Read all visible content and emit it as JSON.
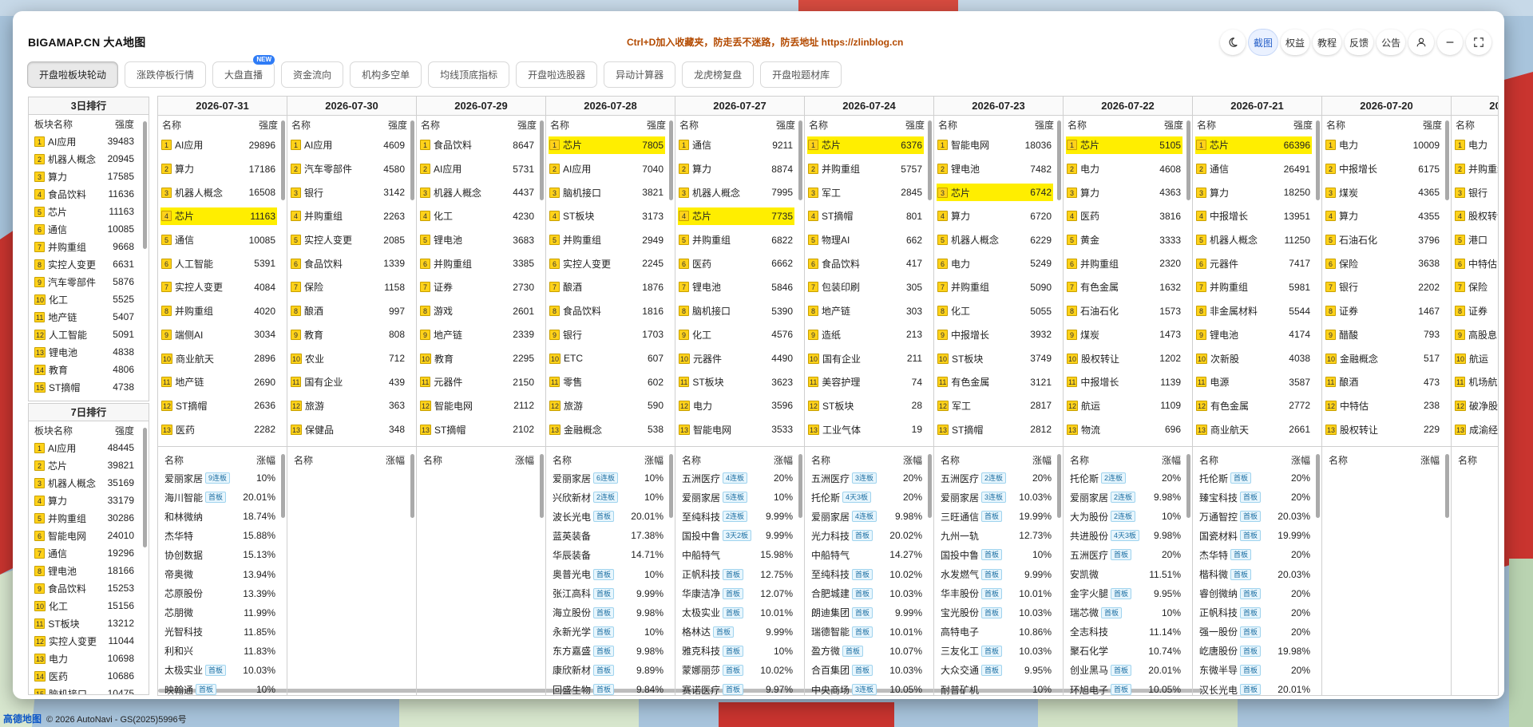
{
  "app": {
    "title": "BIGAMAP.CN 大A地图",
    "notice": "Ctrl+D加入收藏夹，防走丢不迷路，防丢地址 https://zlinblog.cn"
  },
  "top_buttons": [
    "截图",
    "权益",
    "教程",
    "反馈",
    "公告"
  ],
  "tabs": [
    {
      "label": "开盘啦板块轮动",
      "active": true
    },
    {
      "label": "涨跌停板行情"
    },
    {
      "label": "大盘直播",
      "badge": "NEW"
    },
    {
      "label": "资金流向"
    },
    {
      "label": "机构多空单"
    },
    {
      "label": "均线顶底指标"
    },
    {
      "label": "开盘啦选股器"
    },
    {
      "label": "异动计算器"
    },
    {
      "label": "龙虎榜复盘"
    },
    {
      "label": "开盘啦题材库"
    }
  ],
  "rank3": {
    "title": "3日排行",
    "col_name": "板块名称",
    "col_strength": "强度",
    "rows": [
      [
        "AI应用",
        "39483"
      ],
      [
        "机器人概念",
        "20945"
      ],
      [
        "算力",
        "17585"
      ],
      [
        "食品饮料",
        "11636"
      ],
      [
        "芯片",
        "11163"
      ],
      [
        "通信",
        "10085"
      ],
      [
        "并购重组",
        "9668"
      ],
      [
        "实控人变更",
        "6631"
      ],
      [
        "汽车零部件",
        "5876"
      ],
      [
        "化工",
        "5525"
      ],
      [
        "地产链",
        "5407"
      ],
      [
        "人工智能",
        "5091"
      ],
      [
        "锂电池",
        "4838"
      ],
      [
        "教育",
        "4806"
      ],
      [
        "ST摘帽",
        "4738"
      ]
    ]
  },
  "rank7": {
    "title": "7日排行",
    "col_name": "板块名称",
    "col_strength": "强度",
    "rows": [
      [
        "AI应用",
        "48445"
      ],
      [
        "芯片",
        "39821"
      ],
      [
        "机器人概念",
        "35169"
      ],
      [
        "算力",
        "33179"
      ],
      [
        "并购重组",
        "30286"
      ],
      [
        "智能电网",
        "24010"
      ],
      [
        "通信",
        "19296"
      ],
      [
        "锂电池",
        "18166"
      ],
      [
        "食品饮料",
        "15253"
      ],
      [
        "化工",
        "15156"
      ],
      [
        "ST板块",
        "13212"
      ],
      [
        "实控人变更",
        "11044"
      ],
      [
        "电力",
        "10698"
      ],
      [
        "医药",
        "10686"
      ],
      [
        "脑机接口",
        "10475"
      ]
    ]
  },
  "grid": {
    "col_name": "名称",
    "col_strength": "强度",
    "col_change": "涨幅",
    "days": [
      {
        "date": "2026-07-31",
        "sectors": [
          [
            "AI应用",
            "29896"
          ],
          [
            "算力",
            "17186"
          ],
          [
            "机器人概念",
            "16508"
          ],
          [
            "芯片",
            "11163"
          ],
          [
            "通信",
            "10085"
          ],
          [
            "人工智能",
            "5391"
          ],
          [
            "实控人变更",
            "4084"
          ],
          [
            "并购重组",
            "4020"
          ],
          [
            "端侧AI",
            "3034"
          ],
          [
            "商业航天",
            "2896"
          ],
          [
            "地产链",
            "2690"
          ],
          [
            "ST摘帽",
            "2636"
          ],
          [
            "医药",
            "2282"
          ]
        ],
        "highlight": 4,
        "stocks": [
          [
            "爱丽家居",
            "9连板",
            "10%"
          ],
          [
            "海川智能",
            "首板",
            "20.01%"
          ],
          [
            "和林微纳",
            "",
            "18.74%"
          ],
          [
            "杰华特",
            "",
            "15.88%"
          ],
          [
            "协创数据",
            "",
            "15.13%"
          ],
          [
            "帝奥微",
            "",
            "13.94%"
          ],
          [
            "芯原股份",
            "",
            "13.39%"
          ],
          [
            "芯朋微",
            "",
            "11.99%"
          ],
          [
            "光智科技",
            "",
            "11.85%"
          ],
          [
            "利和兴",
            "",
            "11.83%"
          ],
          [
            "太极实业",
            "首板",
            "10.03%"
          ],
          [
            "映翰通",
            "首板",
            "10%"
          ]
        ]
      },
      {
        "date": "2026-07-30",
        "sectors": [
          [
            "AI应用",
            "4609"
          ],
          [
            "汽车零部件",
            "4580"
          ],
          [
            "银行",
            "3142"
          ],
          [
            "并购重组",
            "2263"
          ],
          [
            "实控人变更",
            "2085"
          ],
          [
            "食品饮料",
            "1339"
          ],
          [
            "保险",
            "1158"
          ],
          [
            "酿酒",
            "997"
          ],
          [
            "教育",
            "808"
          ],
          [
            "农业",
            "712"
          ],
          [
            "国有企业",
            "439"
          ],
          [
            "旅游",
            "363"
          ],
          [
            "保健品",
            "348"
          ]
        ],
        "highlight": 0,
        "stocks": []
      },
      {
        "date": "2026-07-29",
        "sectors": [
          [
            "食品饮料",
            "8647"
          ],
          [
            "AI应用",
            "5731"
          ],
          [
            "机器人概念",
            "4437"
          ],
          [
            "化工",
            "4230"
          ],
          [
            "锂电池",
            "3683"
          ],
          [
            "并购重组",
            "3385"
          ],
          [
            "证券",
            "2730"
          ],
          [
            "游戏",
            "2601"
          ],
          [
            "地产链",
            "2339"
          ],
          [
            "教育",
            "2295"
          ],
          [
            "元器件",
            "2150"
          ],
          [
            "智能电网",
            "2112"
          ],
          [
            "ST摘帽",
            "2102"
          ]
        ],
        "highlight": 0,
        "stocks": []
      },
      {
        "date": "2026-07-28",
        "sectors": [
          [
            "芯片",
            "7805"
          ],
          [
            "AI应用",
            "7040"
          ],
          [
            "脑机接口",
            "3821"
          ],
          [
            "ST板块",
            "3173"
          ],
          [
            "并购重组",
            "2949"
          ],
          [
            "实控人变更",
            "2245"
          ],
          [
            "酿酒",
            "1876"
          ],
          [
            "食品饮料",
            "1816"
          ],
          [
            "银行",
            "1703"
          ],
          [
            "ETC",
            "607"
          ],
          [
            "零售",
            "602"
          ],
          [
            "旅游",
            "590"
          ],
          [
            "金融概念",
            "538"
          ]
        ],
        "highlight": 1,
        "stocks": [
          [
            "爱丽家居",
            "6连板",
            "10%"
          ],
          [
            "兴欣新材",
            "2连板",
            "10%"
          ],
          [
            "波长光电",
            "首板",
            "20.01%"
          ],
          [
            "蓝英装备",
            "",
            "17.38%"
          ],
          [
            "华辰装备",
            "",
            "14.71%"
          ],
          [
            "奥普光电",
            "首板",
            "10%"
          ],
          [
            "张江高科",
            "首板",
            "9.99%"
          ],
          [
            "海立股份",
            "首板",
            "9.98%"
          ],
          [
            "永新光学",
            "首板",
            "10%"
          ],
          [
            "东方嘉盛",
            "首板",
            "9.98%"
          ],
          [
            "康欣新材",
            "首板",
            "9.89%"
          ],
          [
            "回盛生物",
            "首板",
            "9.84%"
          ]
        ]
      },
      {
        "date": "2026-07-27",
        "sectors": [
          [
            "通信",
            "9211"
          ],
          [
            "算力",
            "8874"
          ],
          [
            "机器人概念",
            "7995"
          ],
          [
            "芯片",
            "7735"
          ],
          [
            "并购重组",
            "6822"
          ],
          [
            "医药",
            "6662"
          ],
          [
            "锂电池",
            "5846"
          ],
          [
            "脑机接口",
            "5390"
          ],
          [
            "化工",
            "4576"
          ],
          [
            "元器件",
            "4490"
          ],
          [
            "ST板块",
            "3623"
          ],
          [
            "电力",
            "3596"
          ],
          [
            "智能电网",
            "3533"
          ]
        ],
        "highlight": 4,
        "stocks": [
          [
            "五洲医疗",
            "4连板",
            "20%"
          ],
          [
            "爱丽家居",
            "5连板",
            "10%"
          ],
          [
            "至纯科技",
            "2连板",
            "9.99%"
          ],
          [
            "国投中鲁",
            "3天2板",
            "9.99%"
          ],
          [
            "中船特气",
            "",
            "15.98%"
          ],
          [
            "正帆科技",
            "首板",
            "12.75%"
          ],
          [
            "华康洁净",
            "首板",
            "12.07%"
          ],
          [
            "太极实业",
            "首板",
            "10.01%"
          ],
          [
            "格林达",
            "首板",
            "9.99%"
          ],
          [
            "雅克科技",
            "首板",
            "10%"
          ],
          [
            "蒙娜丽莎",
            "首板",
            "10.02%"
          ],
          [
            "赛诺医疗",
            "首板",
            "9.97%"
          ]
        ]
      },
      {
        "date": "2026-07-24",
        "sectors": [
          [
            "芯片",
            "6376"
          ],
          [
            "并购重组",
            "5757"
          ],
          [
            "军工",
            "2845"
          ],
          [
            "ST摘帽",
            "801"
          ],
          [
            "物理AI",
            "662"
          ],
          [
            "食品饮料",
            "417"
          ],
          [
            "包装印刷",
            "305"
          ],
          [
            "地产链",
            "303"
          ],
          [
            "造纸",
            "213"
          ],
          [
            "国有企业",
            "211"
          ],
          [
            "美容护理",
            "74"
          ],
          [
            "ST板块",
            "28"
          ],
          [
            "工业气体",
            "19"
          ]
        ],
        "highlight": 1,
        "stocks": [
          [
            "五洲医疗",
            "3连板",
            "20%"
          ],
          [
            "托伦斯",
            "4天3板",
            "20%"
          ],
          [
            "爱丽家居",
            "4连板",
            "9.98%"
          ],
          [
            "光力科技",
            "首板",
            "20.02%"
          ],
          [
            "中船特气",
            "",
            "14.27%"
          ],
          [
            "至纯科技",
            "首板",
            "10.02%"
          ],
          [
            "合肥城建",
            "首板",
            "10.03%"
          ],
          [
            "朗迪集团",
            "首板",
            "9.99%"
          ],
          [
            "瑞德智能",
            "首板",
            "10.01%"
          ],
          [
            "盈方微",
            "首板",
            "10.07%"
          ],
          [
            "合百集团",
            "首板",
            "10.03%"
          ],
          [
            "中央商场",
            "3连板",
            "10.05%"
          ]
        ]
      },
      {
        "date": "2026-07-23",
        "sectors": [
          [
            "智能电网",
            "18036"
          ],
          [
            "锂电池",
            "7482"
          ],
          [
            "芯片",
            "6742"
          ],
          [
            "算力",
            "6720"
          ],
          [
            "机器人概念",
            "6229"
          ],
          [
            "电力",
            "5249"
          ],
          [
            "并购重组",
            "5090"
          ],
          [
            "化工",
            "5055"
          ],
          [
            "中报增长",
            "3932"
          ],
          [
            "ST板块",
            "3749"
          ],
          [
            "有色金属",
            "3121"
          ],
          [
            "军工",
            "2817"
          ],
          [
            "ST摘帽",
            "2812"
          ]
        ],
        "highlight": 3,
        "stocks": [
          [
            "五洲医疗",
            "2连板",
            "20%"
          ],
          [
            "爱丽家居",
            "3连板",
            "10.03%"
          ],
          [
            "三旺通信",
            "首板",
            "19.99%"
          ],
          [
            "九州一轨",
            "",
            "12.73%"
          ],
          [
            "国投中鲁",
            "首板",
            "10%"
          ],
          [
            "水发燃气",
            "首板",
            "9.99%"
          ],
          [
            "华丰股份",
            "首板",
            "10.01%"
          ],
          [
            "宝光股份",
            "首板",
            "10.03%"
          ],
          [
            "高特电子",
            "",
            "10.86%"
          ],
          [
            "三友化工",
            "首板",
            "10.03%"
          ],
          [
            "大众交通",
            "首板",
            "9.95%"
          ],
          [
            "耐普矿机",
            "",
            "10%"
          ]
        ]
      },
      {
        "date": "2026-07-22",
        "sectors": [
          [
            "芯片",
            "5105"
          ],
          [
            "电力",
            "4608"
          ],
          [
            "算力",
            "4363"
          ],
          [
            "医药",
            "3816"
          ],
          [
            "黄金",
            "3333"
          ],
          [
            "并购重组",
            "2320"
          ],
          [
            "有色金属",
            "1632"
          ],
          [
            "石油石化",
            "1573"
          ],
          [
            "煤炭",
            "1473"
          ],
          [
            "股权转让",
            "1202"
          ],
          [
            "中报增长",
            "1139"
          ],
          [
            "航运",
            "1109"
          ],
          [
            "物流",
            "696"
          ]
        ],
        "highlight": 1,
        "stocks": [
          [
            "托伦斯",
            "2连板",
            "20%"
          ],
          [
            "爱丽家居",
            "2连板",
            "9.98%"
          ],
          [
            "大为股份",
            "2连板",
            "10%"
          ],
          [
            "共进股份",
            "4天3板",
            "9.98%"
          ],
          [
            "五洲医疗",
            "首板",
            "20%"
          ],
          [
            "安凯微",
            "",
            "11.51%"
          ],
          [
            "金字火腿",
            "首板",
            "9.95%"
          ],
          [
            "瑞芯微",
            "首板",
            "10%"
          ],
          [
            "全志科技",
            "",
            "11.14%"
          ],
          [
            "聚石化学",
            "",
            "10.74%"
          ],
          [
            "创业黑马",
            "首板",
            "20.01%"
          ],
          [
            "环旭电子",
            "首板",
            "10.05%"
          ]
        ]
      },
      {
        "date": "2026-07-21",
        "sectors": [
          [
            "芯片",
            "66396"
          ],
          [
            "通信",
            "26491"
          ],
          [
            "算力",
            "18250"
          ],
          [
            "中报增长",
            "13951"
          ],
          [
            "机器人概念",
            "11250"
          ],
          [
            "元器件",
            "7417"
          ],
          [
            "并购重组",
            "5981"
          ],
          [
            "非金属材料",
            "5544"
          ],
          [
            "锂电池",
            "4174"
          ],
          [
            "次新股",
            "4038"
          ],
          [
            "电源",
            "3587"
          ],
          [
            "有色金属",
            "2772"
          ],
          [
            "商业航天",
            "2661"
          ]
        ],
        "highlight": 1,
        "stocks": [
          [
            "托伦斯",
            "首板",
            "20%"
          ],
          [
            "臻宝科技",
            "首板",
            "20%"
          ],
          [
            "万通智控",
            "首板",
            "20.03%"
          ],
          [
            "国瓷材料",
            "首板",
            "19.99%"
          ],
          [
            "杰华特",
            "首板",
            "20%"
          ],
          [
            "楷科微",
            "首板",
            "20.03%"
          ],
          [
            "睿创微纳",
            "首板",
            "20%"
          ],
          [
            "正帆科技",
            "首板",
            "20%"
          ],
          [
            "强一股份",
            "首板",
            "20%"
          ],
          [
            "屹唐股份",
            "首板",
            "19.98%"
          ],
          [
            "东微半导",
            "首板",
            "20%"
          ],
          [
            "汉长光电",
            "首板",
            "20.01%"
          ]
        ]
      },
      {
        "date": "2026-07-20",
        "sectors": [
          [
            "电力",
            "10009"
          ],
          [
            "中报增长",
            "6175"
          ],
          [
            "煤炭",
            "4365"
          ],
          [
            "算力",
            "4355"
          ],
          [
            "石油石化",
            "3796"
          ],
          [
            "保险",
            "3638"
          ],
          [
            "银行",
            "2202"
          ],
          [
            "证券",
            "1467"
          ],
          [
            "醋酸",
            "793"
          ],
          [
            "金融概念",
            "517"
          ],
          [
            "酿酒",
            "473"
          ],
          [
            "中特估",
            "238"
          ],
          [
            "股权转让",
            "229"
          ]
        ],
        "highlight": 0,
        "stocks": []
      },
      {
        "date": "2026-07-17",
        "sectors": [
          [
            "电力",
            ""
          ],
          [
            "并购重组",
            ""
          ],
          [
            "银行",
            ""
          ],
          [
            "股权转让",
            ""
          ],
          [
            "港口",
            ""
          ],
          [
            "中特估",
            ""
          ],
          [
            "保险",
            ""
          ],
          [
            "证券",
            ""
          ],
          [
            "高股息",
            ""
          ],
          [
            "航运",
            ""
          ],
          [
            "机场航空",
            ""
          ],
          [
            "破净股",
            ""
          ],
          [
            "成渝经济",
            ""
          ]
        ],
        "highlight": 0,
        "stocks": []
      }
    ]
  },
  "footer": {
    "logo": "高德地图",
    "text": "© 2026 AutoNavi - GS(2025)5996号"
  },
  "colors": {
    "highlight": "#ffee00",
    "accent": "#2a62c9",
    "notice": "#b34a00",
    "rank_badge": "#ffd21a"
  },
  "icons": [
    "moon-icon",
    "user-icon",
    "minimize-icon",
    "fullscreen-icon"
  ]
}
